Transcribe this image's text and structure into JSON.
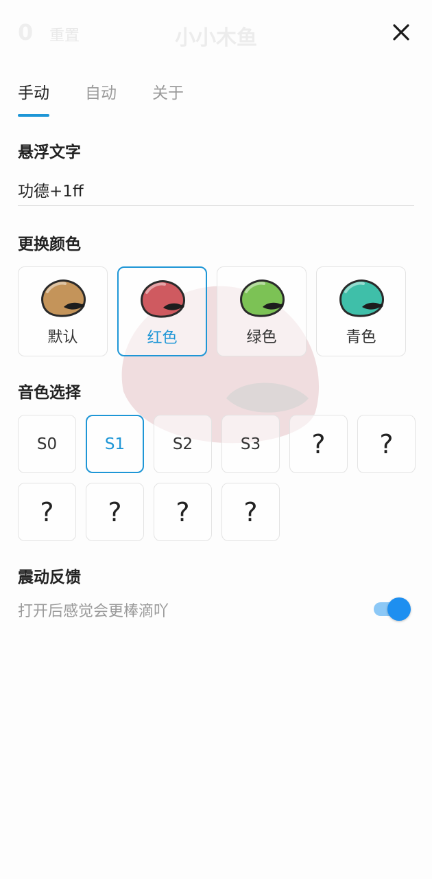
{
  "background_app": {
    "count": "0",
    "reset_label": "重置",
    "title": "小小木鱼"
  },
  "tabs": [
    {
      "label": "手动",
      "active": true
    },
    {
      "label": "自动",
      "active": false
    },
    {
      "label": "关于",
      "active": false
    }
  ],
  "float_text": {
    "title": "悬浮文字",
    "value": "功德+1ff"
  },
  "color_section": {
    "title": "更换颜色",
    "options": [
      {
        "label": "默认",
        "color": "#c4945a",
        "selected": false
      },
      {
        "label": "红色",
        "color": "#cf5a60",
        "selected": true
      },
      {
        "label": "绿色",
        "color": "#7cc255",
        "selected": false
      },
      {
        "label": "青色",
        "color": "#3fbfa9",
        "selected": false
      }
    ]
  },
  "sound_section": {
    "title": "音色选择",
    "options": [
      {
        "label": "S0",
        "selected": false
      },
      {
        "label": "S1",
        "selected": true
      },
      {
        "label": "S2",
        "selected": false
      },
      {
        "label": "S3",
        "selected": false
      },
      {
        "label": "?",
        "selected": false
      },
      {
        "label": "?",
        "selected": false
      },
      {
        "label": "?",
        "selected": false
      },
      {
        "label": "?",
        "selected": false
      },
      {
        "label": "?",
        "selected": false
      },
      {
        "label": "?",
        "selected": false
      }
    ]
  },
  "vibration": {
    "title": "震动反馈",
    "description": "打开后感觉会更棒滴吖",
    "enabled": true
  },
  "colors": {
    "accent": "#1e96d6",
    "toggle_knob": "#1e8ff0",
    "toggle_track": "#8cc8f6"
  }
}
